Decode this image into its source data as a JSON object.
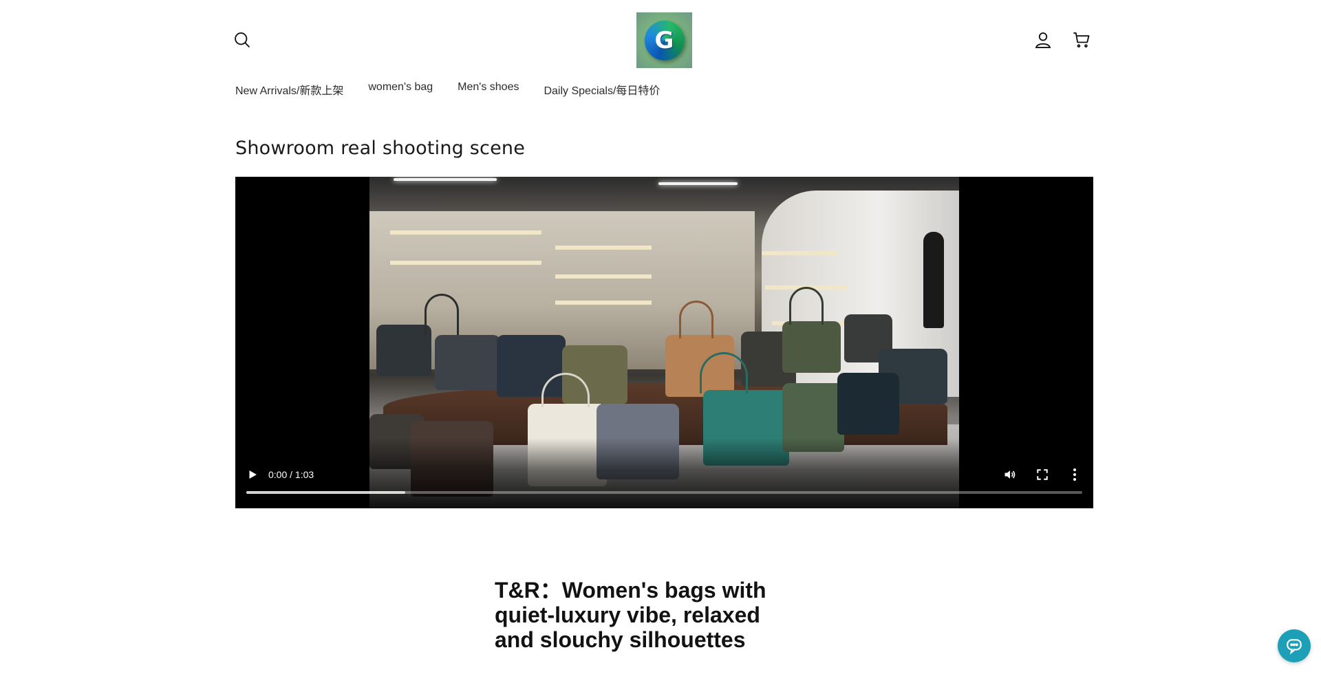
{
  "header": {
    "logo_letter": "G",
    "icons": {
      "search": "search-icon",
      "account": "account-icon",
      "cart": "cart-icon"
    }
  },
  "nav": {
    "items": [
      {
        "label": "New Arrivals/新款上架"
      },
      {
        "label": "women's bag"
      },
      {
        "label": "Men's shoes"
      },
      {
        "label": "Daily Specials/每日特价"
      }
    ]
  },
  "section": {
    "title": "Showroom real shooting scene"
  },
  "video": {
    "time": "0:00 / 1:03",
    "buffered_fraction": 0.19,
    "icons": {
      "play": "play-icon",
      "volume": "volume-icon",
      "fullscreen": "fullscreen-icon",
      "more": "more-vert-icon"
    }
  },
  "feature": {
    "headline": "T&R：Women's bags with quiet-luxury vibe, relaxed and slouchy silhouettes"
  },
  "chat": {
    "icon": "chat-icon",
    "color": "#1e9fb8"
  }
}
